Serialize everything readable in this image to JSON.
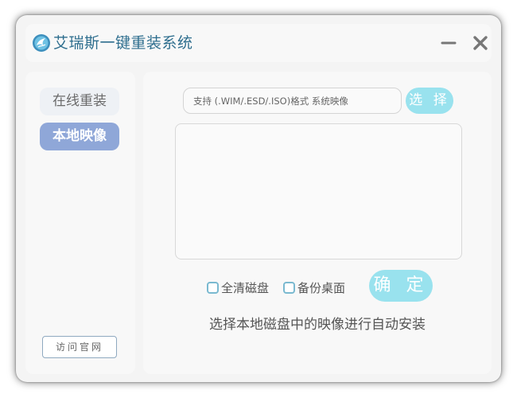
{
  "app": {
    "title": "艾瑞斯一键重装系统",
    "logo_icon": "phoenix-globe-logo-icon",
    "minimize_icon": "minimize-icon",
    "close_icon": "close-icon"
  },
  "sidebar": {
    "items": [
      {
        "label": "在线重装",
        "active": false
      },
      {
        "label": "本地映像",
        "active": true
      }
    ],
    "visit_label": "访问官网"
  },
  "main": {
    "path_input": {
      "value": "",
      "placeholder": "支持 (.WIM/.ESD/.ISO)格式 系统映像"
    },
    "select_label": "选 择",
    "options": [
      {
        "label": "全清磁盘",
        "checked": false
      },
      {
        "label": "备份桌面",
        "checked": false
      }
    ],
    "confirm_label": "确 定",
    "status": "选择本地磁盘中的映像进行自动安装"
  },
  "colors": {
    "accent": "#99e2ee",
    "nav_active": "#8fa7d8",
    "title": "#2e6e8e"
  }
}
